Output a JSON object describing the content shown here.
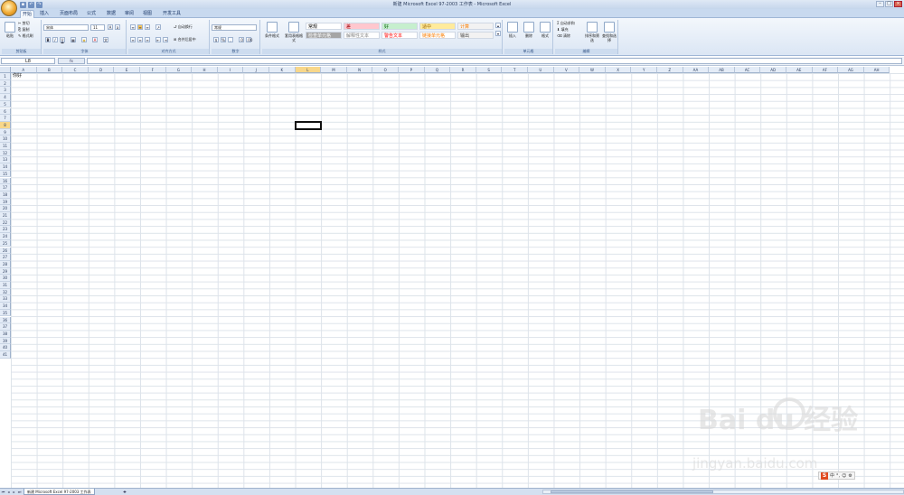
{
  "window": {
    "title": "新建 Microsoft Excel 97-2003 工作表 - Microsoft Excel"
  },
  "qat": [
    "save",
    "undo",
    "redo"
  ],
  "tabs": [
    "开始",
    "插入",
    "页面布局",
    "公式",
    "数据",
    "审阅",
    "视图",
    "开发工具"
  ],
  "ribbon": {
    "clipboard": {
      "paste": "粘贴",
      "cut": "剪切",
      "copy": "复制",
      "format_painter": "格式刷",
      "label": "剪贴板"
    },
    "font": {
      "name": "宋体",
      "size": "11",
      "bold": "B",
      "italic": "I",
      "underline": "U",
      "label": "字体"
    },
    "alignment": {
      "wrap": "自动换行",
      "merge": "合并后居中",
      "label": "对齐方式"
    },
    "number": {
      "format": "常规",
      "percent": "%",
      "comma": ",",
      "label": "数字"
    },
    "styles": {
      "conditional": "条件格式",
      "table": "套用表格格式",
      "cells": [
        {
          "text": "常规",
          "bg": "#ffffff",
          "color": "#000000"
        },
        {
          "text": "差",
          "bg": "#ffc7ce",
          "color": "#9c0006"
        },
        {
          "text": "好",
          "bg": "#c6efce",
          "color": "#006100"
        },
        {
          "text": "适中",
          "bg": "#ffeb9c",
          "color": "#9c6500"
        },
        {
          "text": "计算",
          "bg": "#f2f2f2",
          "color": "#fa7d00"
        },
        {
          "text": "检查单元格",
          "bg": "#a5a5a5",
          "color": "#ffffff"
        },
        {
          "text": "解释性文本",
          "bg": "#ffffff",
          "color": "#7f7f7f"
        },
        {
          "text": "警告文本",
          "bg": "#ffffff",
          "color": "#ff0000"
        },
        {
          "text": "链接单元格",
          "bg": "#ffffff",
          "color": "#fa7d00"
        },
        {
          "text": "输出",
          "bg": "#f2f2f2",
          "color": "#3f3f3f"
        }
      ],
      "label": "样式"
    },
    "cells": {
      "insert": "插入",
      "delete": "删除",
      "format": "格式",
      "label": "单元格"
    },
    "editing": {
      "autosum": "自动求和",
      "fill": "填充",
      "clear": "清除",
      "sort": "排序和筛选",
      "find": "查找和选择",
      "label": "编辑"
    }
  },
  "formula": {
    "name_box": "L8",
    "fx": "fx",
    "content": ""
  },
  "columns": [
    "A",
    "B",
    "C",
    "D",
    "E",
    "F",
    "G",
    "H",
    "I",
    "J",
    "K",
    "L",
    "M",
    "N",
    "O",
    "P",
    "Q",
    "R",
    "S",
    "T",
    "U",
    "V",
    "W",
    "X",
    "Y",
    "Z",
    "AA",
    "AB",
    "AC",
    "AD",
    "AE",
    "AF",
    "AG",
    "AH"
  ],
  "rows": [
    "1",
    "2",
    "3",
    "4",
    "5",
    "6",
    "7",
    "8",
    "9",
    "10",
    "11",
    "12",
    "13",
    "14",
    "15",
    "16",
    "17",
    "18",
    "19",
    "20",
    "21",
    "22",
    "23",
    "24",
    "25",
    "26",
    "27",
    "28",
    "29",
    "30",
    "31",
    "32",
    "33",
    "34",
    "35",
    "36",
    "37",
    "38",
    "39",
    "40",
    "41"
  ],
  "selected": {
    "col": "L",
    "row": "8"
  },
  "cells": [
    {
      "ref": "A1",
      "text": "你好"
    }
  ],
  "sheets": [
    "新建 Microsoft Excel 97-2003 工作表"
  ],
  "watermark": {
    "logo": "Bai  du 经验",
    "url": "jingyan.baidu.com"
  },
  "ime": {
    "logo": "S",
    "items": [
      "中",
      "°,",
      "☺",
      "⚙"
    ]
  },
  "colors": {
    "accent": "#c8d9ef",
    "selected_header": "#f8d78a"
  }
}
